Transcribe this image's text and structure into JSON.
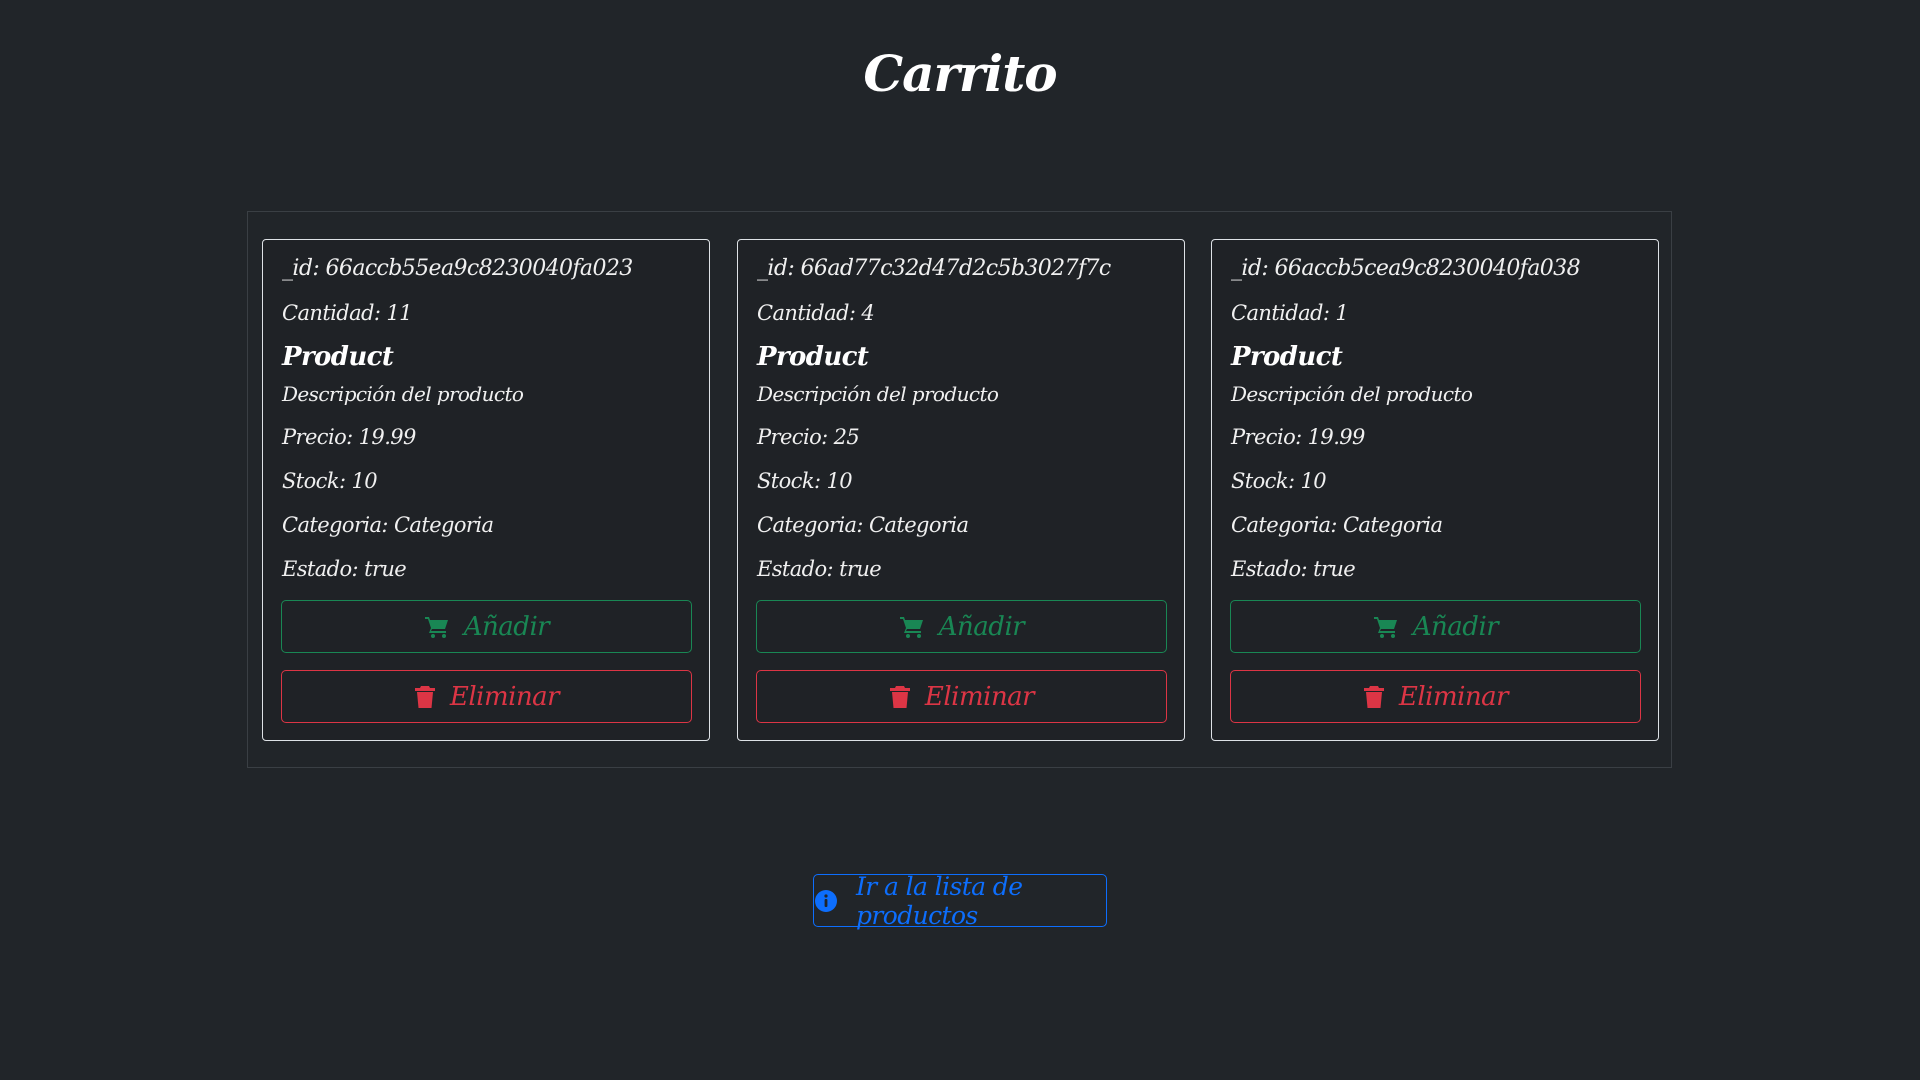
{
  "page": {
    "title": "Carrito"
  },
  "cards": [
    {
      "id_text": "_id: 66accb55ea9c8230040fa023",
      "quantity_text": "Cantidad: 11",
      "name": "Product",
      "description": "Descripción del producto",
      "price_text": "Precio: 19.99",
      "stock_text": "Stock: 10",
      "category_text": "Categoria: Categoria",
      "state_text": "Estado: true",
      "add_label": "Añadir",
      "delete_label": "Eliminar"
    },
    {
      "id_text": "_id: 66ad77c32d47d2c5b3027f7c",
      "quantity_text": "Cantidad: 4",
      "name": "Product",
      "description": "Descripción del producto",
      "price_text": "Precio: 25",
      "stock_text": "Stock: 10",
      "category_text": "Categoria: Categoria",
      "state_text": "Estado: true",
      "add_label": "Añadir",
      "delete_label": "Eliminar"
    },
    {
      "id_text": "_id: 66accb5cea9c8230040fa038",
      "quantity_text": "Cantidad: 1",
      "name": "Product",
      "description": "Descripción del producto",
      "price_text": "Precio: 19.99",
      "stock_text": "Stock: 10",
      "category_text": "Categoria: Categoria",
      "state_text": "Estado: true",
      "add_label": "Añadir",
      "delete_label": "Eliminar"
    }
  ],
  "footer": {
    "products_link_label": "Ir a la lista de productos"
  },
  "icons": {
    "add": "cart-icon",
    "delete": "trash-icon",
    "info": "info-circle-icon"
  },
  "colors": {
    "background": "#212529",
    "success": "#198754",
    "danger": "#dc3545",
    "primary": "#0d6efd"
  }
}
